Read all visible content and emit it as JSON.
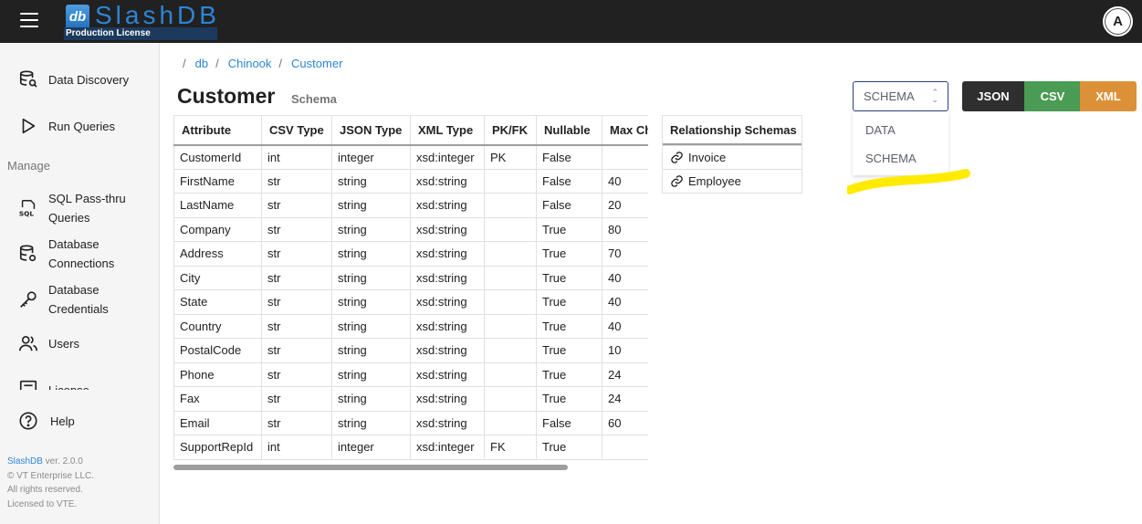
{
  "header": {
    "logo_title": "SlashDB",
    "logo_mark": "db",
    "logo_subtitle": "Production License",
    "avatar_initial": "A"
  },
  "sidebar": {
    "items_top": [
      {
        "label": "Data Discovery",
        "icon": "database-search-icon"
      },
      {
        "label": "Run Queries",
        "icon": "play-icon"
      }
    ],
    "section_label": "Manage",
    "items_manage": [
      {
        "label": "SQL Pass-thru",
        "label2": "Queries",
        "icon": "sql-icon"
      },
      {
        "label": "Database",
        "label2": "Connections",
        "icon": "database-connection-icon"
      },
      {
        "label": "Database",
        "label2": "Credentials",
        "icon": "key-icon"
      },
      {
        "label": "Users",
        "icon": "users-icon"
      },
      {
        "label": "License",
        "icon": "license-icon"
      }
    ],
    "help_label": "Help",
    "footer": {
      "brand": "SlashDB",
      "version": " ver. 2.0.0",
      "line2": "© VT Enterprise LLC.",
      "line3": "All rights reserved.",
      "line4": "Licensed to VTE."
    }
  },
  "breadcrumb": {
    "separator": "/",
    "items": [
      "db",
      "Chinook",
      "Customer"
    ]
  },
  "page": {
    "title": "Customer",
    "subtitle": "Schema"
  },
  "format_select": {
    "value": "SCHEMA",
    "options": [
      "DATA",
      "SCHEMA"
    ]
  },
  "format_buttons": {
    "json": "JSON",
    "csv": "CSV",
    "xml": "XML"
  },
  "colors": {
    "json": "#2f2f2f",
    "csv": "#4a9b54",
    "xml": "#dc9138",
    "link": "#2c85d6",
    "highlight": "#ffeb00"
  },
  "schema_table": {
    "columns": [
      "Attribute",
      "CSV Type",
      "JSON Type",
      "XML Type",
      "PK/FK",
      "Nullable",
      "Max Chars"
    ],
    "rows": [
      [
        "CustomerId",
        "int",
        "integer",
        "xsd:integer",
        "PK",
        "False",
        ""
      ],
      [
        "FirstName",
        "str",
        "string",
        "xsd:string",
        "",
        "False",
        "40"
      ],
      [
        "LastName",
        "str",
        "string",
        "xsd:string",
        "",
        "False",
        "20"
      ],
      [
        "Company",
        "str",
        "string",
        "xsd:string",
        "",
        "True",
        "80"
      ],
      [
        "Address",
        "str",
        "string",
        "xsd:string",
        "",
        "True",
        "70"
      ],
      [
        "City",
        "str",
        "string",
        "xsd:string",
        "",
        "True",
        "40"
      ],
      [
        "State",
        "str",
        "string",
        "xsd:string",
        "",
        "True",
        "40"
      ],
      [
        "Country",
        "str",
        "string",
        "xsd:string",
        "",
        "True",
        "40"
      ],
      [
        "PostalCode",
        "str",
        "string",
        "xsd:string",
        "",
        "True",
        "10"
      ],
      [
        "Phone",
        "str",
        "string",
        "xsd:string",
        "",
        "True",
        "24"
      ],
      [
        "Fax",
        "str",
        "string",
        "xsd:string",
        "",
        "True",
        "24"
      ],
      [
        "Email",
        "str",
        "string",
        "xsd:string",
        "",
        "False",
        "60"
      ],
      [
        "SupportRepId",
        "int",
        "integer",
        "xsd:integer",
        "FK",
        "True",
        ""
      ]
    ]
  },
  "relationships": {
    "header": "Relationship Schemas",
    "items": [
      "Invoice",
      "Employee"
    ]
  }
}
